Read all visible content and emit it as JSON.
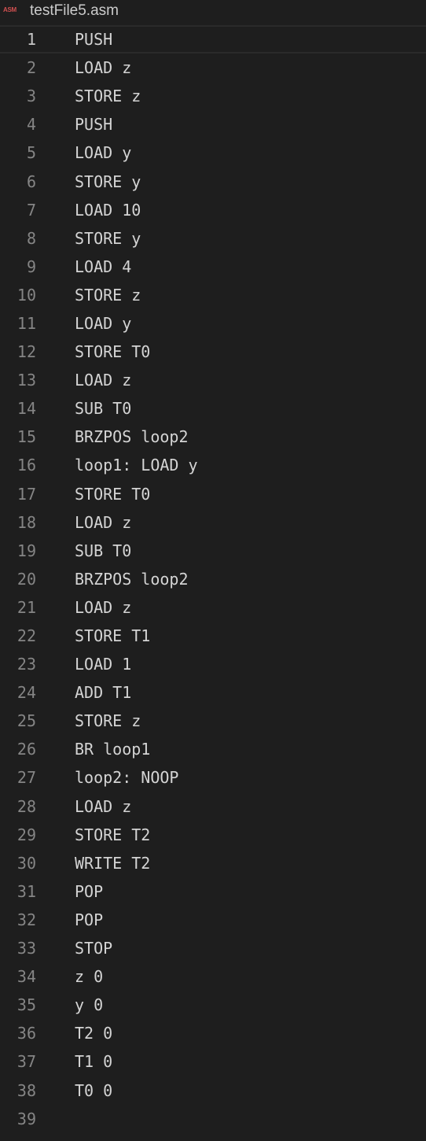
{
  "tab": {
    "icon_text": "ASM",
    "file_name": "testFile5.asm"
  },
  "editor": {
    "current_line": 1,
    "lines": [
      {
        "num": "1",
        "text": "PUSH"
      },
      {
        "num": "2",
        "text": "LOAD z"
      },
      {
        "num": "3",
        "text": "STORE z"
      },
      {
        "num": "4",
        "text": "PUSH"
      },
      {
        "num": "5",
        "text": "LOAD y"
      },
      {
        "num": "6",
        "text": "STORE y"
      },
      {
        "num": "7",
        "text": "LOAD 10"
      },
      {
        "num": "8",
        "text": "STORE y"
      },
      {
        "num": "9",
        "text": "LOAD 4"
      },
      {
        "num": "10",
        "text": "STORE z"
      },
      {
        "num": "11",
        "text": "LOAD y"
      },
      {
        "num": "12",
        "text": "STORE T0"
      },
      {
        "num": "13",
        "text": "LOAD z"
      },
      {
        "num": "14",
        "text": "SUB T0"
      },
      {
        "num": "15",
        "text": "BRZPOS loop2"
      },
      {
        "num": "16",
        "text": "loop1: LOAD y"
      },
      {
        "num": "17",
        "text": "STORE T0"
      },
      {
        "num": "18",
        "text": "LOAD z"
      },
      {
        "num": "19",
        "text": "SUB T0"
      },
      {
        "num": "20",
        "text": "BRZPOS loop2"
      },
      {
        "num": "21",
        "text": "LOAD z"
      },
      {
        "num": "22",
        "text": "STORE T1"
      },
      {
        "num": "23",
        "text": "LOAD 1"
      },
      {
        "num": "24",
        "text": "ADD T1"
      },
      {
        "num": "25",
        "text": "STORE z"
      },
      {
        "num": "26",
        "text": "BR loop1"
      },
      {
        "num": "27",
        "text": "loop2: NOOP"
      },
      {
        "num": "28",
        "text": "LOAD z"
      },
      {
        "num": "29",
        "text": "STORE T2"
      },
      {
        "num": "30",
        "text": "WRITE T2"
      },
      {
        "num": "31",
        "text": "POP"
      },
      {
        "num": "32",
        "text": "POP"
      },
      {
        "num": "33",
        "text": "STOP"
      },
      {
        "num": "34",
        "text": "z 0"
      },
      {
        "num": "35",
        "text": "y 0"
      },
      {
        "num": "36",
        "text": "T2 0"
      },
      {
        "num": "37",
        "text": "T1 0"
      },
      {
        "num": "38",
        "text": "T0 0"
      },
      {
        "num": "39",
        "text": ""
      }
    ]
  }
}
